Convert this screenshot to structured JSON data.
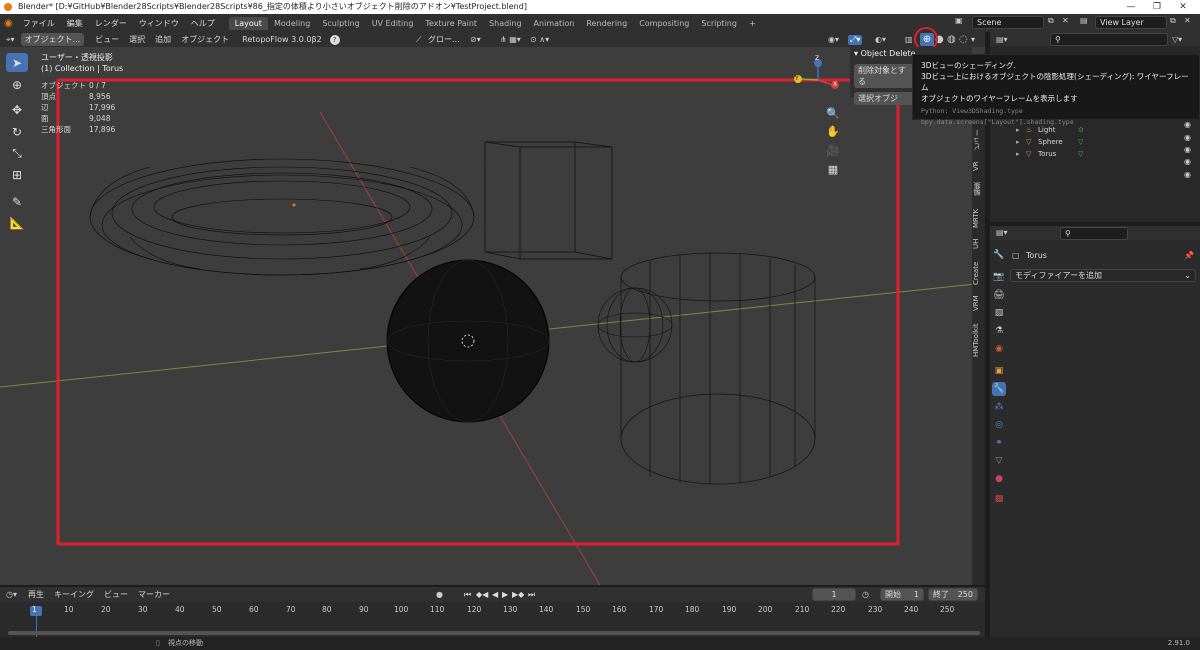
{
  "window": {
    "title": "Blender* [D:¥GitHub¥Blender28Scripts¥Blender28Scripts¥86_指定の体積より小さいオブジェクト削除のアドオン¥TestProject.blend]",
    "minimize": "—",
    "maximize": "❐",
    "close": "✕"
  },
  "menus": [
    "ファイル",
    "編集",
    "レンダー",
    "ウィンドウ",
    "ヘルプ"
  ],
  "workspaces": [
    "Layout",
    "Modeling",
    "Sculpting",
    "UV Editing",
    "Texture Paint",
    "Shading",
    "Animation",
    "Rendering",
    "Compositing",
    "Scripting"
  ],
  "add_workspace": "+",
  "scene": {
    "label": "Scene",
    "view_layer": "View Layer"
  },
  "viewport_header": {
    "mode": "オブジェクト...",
    "menus": [
      "ビュー",
      "選択",
      "追加",
      "オブジェクト"
    ],
    "addon": "RetopoFlow 3.0.0β2",
    "help": "?",
    "transform": "グロー..."
  },
  "viewport": {
    "view_name": "ユーザー・透視投影",
    "collection": "(1) Collection | Torus",
    "stats": [
      {
        "label": "オブジェクト",
        "value": "0 / 7"
      },
      {
        "label": "頂点",
        "value": "8,956"
      },
      {
        "label": "辺",
        "value": "17,996"
      },
      {
        "label": "面",
        "value": "9,048"
      },
      {
        "label": "三角形面",
        "value": "17,896"
      }
    ],
    "gizmo": {
      "x": "X",
      "y": "Y",
      "z": "Z"
    }
  },
  "side_tabs": [
    "ビュー",
    "VR",
    "編集",
    "MRTK",
    "UH",
    "Create",
    "VRM",
    "HMToolkit"
  ],
  "operator_panel": {
    "title": "Object Delete",
    "btn1": "削除対象とする",
    "btn2": "選択オブジ"
  },
  "tooltip": {
    "title": "3Dビューのシェーディング.",
    "line2": "3Dビュー上におけるオブジェクトの陰影処理(シェーディング): ワイヤーフレーム",
    "line3": "オブジェクトのワイヤーフレームを表示します",
    "python1": "Python: View3DShading.type",
    "python2": "bpy.data.screens[\"Layout\"].shading.type"
  },
  "outliner": {
    "items": [
      {
        "name": "Light"
      },
      {
        "name": "Sphere"
      },
      {
        "name": "Torus"
      }
    ]
  },
  "properties": {
    "object_name": "Torus",
    "add_modifier": "モディファイアーを追加"
  },
  "timeline": {
    "menus": [
      "再生",
      "キーイング",
      "ビュー",
      "マーカー"
    ],
    "current_frame": "1",
    "start_label": "開始",
    "start": "1",
    "end_label": "終了",
    "end": "250",
    "ticks": [
      "1",
      "10",
      "20",
      "30",
      "40",
      "50",
      "60",
      "70",
      "80",
      "90",
      "100",
      "110",
      "120",
      "130",
      "140",
      "150",
      "160",
      "170",
      "180",
      "190",
      "200",
      "210",
      "220",
      "230",
      "240",
      "250"
    ]
  },
  "statusbar": {
    "hint": "視点の移動",
    "version": "2.91.0"
  },
  "colors": {
    "highlight": "#e0202a",
    "accent": "#4772b3",
    "x_axis": "#d04040",
    "y_axis": "#8ab040"
  }
}
